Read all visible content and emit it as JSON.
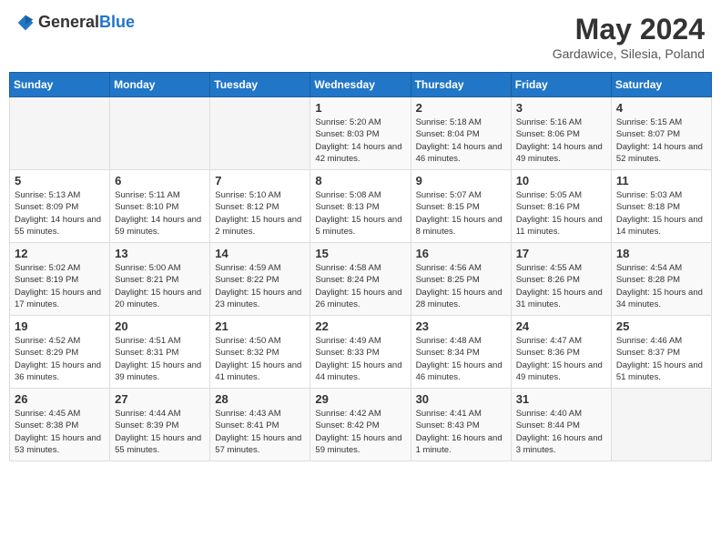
{
  "header": {
    "logo_general": "General",
    "logo_blue": "Blue",
    "title": "May 2024",
    "subtitle": "Gardawice, Silesia, Poland"
  },
  "days_of_week": [
    "Sunday",
    "Monday",
    "Tuesday",
    "Wednesday",
    "Thursday",
    "Friday",
    "Saturday"
  ],
  "weeks": [
    [
      {
        "day": "",
        "sunrise": "",
        "sunset": "",
        "daylight": ""
      },
      {
        "day": "",
        "sunrise": "",
        "sunset": "",
        "daylight": ""
      },
      {
        "day": "",
        "sunrise": "",
        "sunset": "",
        "daylight": ""
      },
      {
        "day": "1",
        "sunrise": "Sunrise: 5:20 AM",
        "sunset": "Sunset: 8:03 PM",
        "daylight": "Daylight: 14 hours and 42 minutes."
      },
      {
        "day": "2",
        "sunrise": "Sunrise: 5:18 AM",
        "sunset": "Sunset: 8:04 PM",
        "daylight": "Daylight: 14 hours and 46 minutes."
      },
      {
        "day": "3",
        "sunrise": "Sunrise: 5:16 AM",
        "sunset": "Sunset: 8:06 PM",
        "daylight": "Daylight: 14 hours and 49 minutes."
      },
      {
        "day": "4",
        "sunrise": "Sunrise: 5:15 AM",
        "sunset": "Sunset: 8:07 PM",
        "daylight": "Daylight: 14 hours and 52 minutes."
      }
    ],
    [
      {
        "day": "5",
        "sunrise": "Sunrise: 5:13 AM",
        "sunset": "Sunset: 8:09 PM",
        "daylight": "Daylight: 14 hours and 55 minutes."
      },
      {
        "day": "6",
        "sunrise": "Sunrise: 5:11 AM",
        "sunset": "Sunset: 8:10 PM",
        "daylight": "Daylight: 14 hours and 59 minutes."
      },
      {
        "day": "7",
        "sunrise": "Sunrise: 5:10 AM",
        "sunset": "Sunset: 8:12 PM",
        "daylight": "Daylight: 15 hours and 2 minutes."
      },
      {
        "day": "8",
        "sunrise": "Sunrise: 5:08 AM",
        "sunset": "Sunset: 8:13 PM",
        "daylight": "Daylight: 15 hours and 5 minutes."
      },
      {
        "day": "9",
        "sunrise": "Sunrise: 5:07 AM",
        "sunset": "Sunset: 8:15 PM",
        "daylight": "Daylight: 15 hours and 8 minutes."
      },
      {
        "day": "10",
        "sunrise": "Sunrise: 5:05 AM",
        "sunset": "Sunset: 8:16 PM",
        "daylight": "Daylight: 15 hours and 11 minutes."
      },
      {
        "day": "11",
        "sunrise": "Sunrise: 5:03 AM",
        "sunset": "Sunset: 8:18 PM",
        "daylight": "Daylight: 15 hours and 14 minutes."
      }
    ],
    [
      {
        "day": "12",
        "sunrise": "Sunrise: 5:02 AM",
        "sunset": "Sunset: 8:19 PM",
        "daylight": "Daylight: 15 hours and 17 minutes."
      },
      {
        "day": "13",
        "sunrise": "Sunrise: 5:00 AM",
        "sunset": "Sunset: 8:21 PM",
        "daylight": "Daylight: 15 hours and 20 minutes."
      },
      {
        "day": "14",
        "sunrise": "Sunrise: 4:59 AM",
        "sunset": "Sunset: 8:22 PM",
        "daylight": "Daylight: 15 hours and 23 minutes."
      },
      {
        "day": "15",
        "sunrise": "Sunrise: 4:58 AM",
        "sunset": "Sunset: 8:24 PM",
        "daylight": "Daylight: 15 hours and 26 minutes."
      },
      {
        "day": "16",
        "sunrise": "Sunrise: 4:56 AM",
        "sunset": "Sunset: 8:25 PM",
        "daylight": "Daylight: 15 hours and 28 minutes."
      },
      {
        "day": "17",
        "sunrise": "Sunrise: 4:55 AM",
        "sunset": "Sunset: 8:26 PM",
        "daylight": "Daylight: 15 hours and 31 minutes."
      },
      {
        "day": "18",
        "sunrise": "Sunrise: 4:54 AM",
        "sunset": "Sunset: 8:28 PM",
        "daylight": "Daylight: 15 hours and 34 minutes."
      }
    ],
    [
      {
        "day": "19",
        "sunrise": "Sunrise: 4:52 AM",
        "sunset": "Sunset: 8:29 PM",
        "daylight": "Daylight: 15 hours and 36 minutes."
      },
      {
        "day": "20",
        "sunrise": "Sunrise: 4:51 AM",
        "sunset": "Sunset: 8:31 PM",
        "daylight": "Daylight: 15 hours and 39 minutes."
      },
      {
        "day": "21",
        "sunrise": "Sunrise: 4:50 AM",
        "sunset": "Sunset: 8:32 PM",
        "daylight": "Daylight: 15 hours and 41 minutes."
      },
      {
        "day": "22",
        "sunrise": "Sunrise: 4:49 AM",
        "sunset": "Sunset: 8:33 PM",
        "daylight": "Daylight: 15 hours and 44 minutes."
      },
      {
        "day": "23",
        "sunrise": "Sunrise: 4:48 AM",
        "sunset": "Sunset: 8:34 PM",
        "daylight": "Daylight: 15 hours and 46 minutes."
      },
      {
        "day": "24",
        "sunrise": "Sunrise: 4:47 AM",
        "sunset": "Sunset: 8:36 PM",
        "daylight": "Daylight: 15 hours and 49 minutes."
      },
      {
        "day": "25",
        "sunrise": "Sunrise: 4:46 AM",
        "sunset": "Sunset: 8:37 PM",
        "daylight": "Daylight: 15 hours and 51 minutes."
      }
    ],
    [
      {
        "day": "26",
        "sunrise": "Sunrise: 4:45 AM",
        "sunset": "Sunset: 8:38 PM",
        "daylight": "Daylight: 15 hours and 53 minutes."
      },
      {
        "day": "27",
        "sunrise": "Sunrise: 4:44 AM",
        "sunset": "Sunset: 8:39 PM",
        "daylight": "Daylight: 15 hours and 55 minutes."
      },
      {
        "day": "28",
        "sunrise": "Sunrise: 4:43 AM",
        "sunset": "Sunset: 8:41 PM",
        "daylight": "Daylight: 15 hours and 57 minutes."
      },
      {
        "day": "29",
        "sunrise": "Sunrise: 4:42 AM",
        "sunset": "Sunset: 8:42 PM",
        "daylight": "Daylight: 15 hours and 59 minutes."
      },
      {
        "day": "30",
        "sunrise": "Sunrise: 4:41 AM",
        "sunset": "Sunset: 8:43 PM",
        "daylight": "Daylight: 16 hours and 1 minute."
      },
      {
        "day": "31",
        "sunrise": "Sunrise: 4:40 AM",
        "sunset": "Sunset: 8:44 PM",
        "daylight": "Daylight: 16 hours and 3 minutes."
      },
      {
        "day": "",
        "sunrise": "",
        "sunset": "",
        "daylight": ""
      }
    ]
  ]
}
